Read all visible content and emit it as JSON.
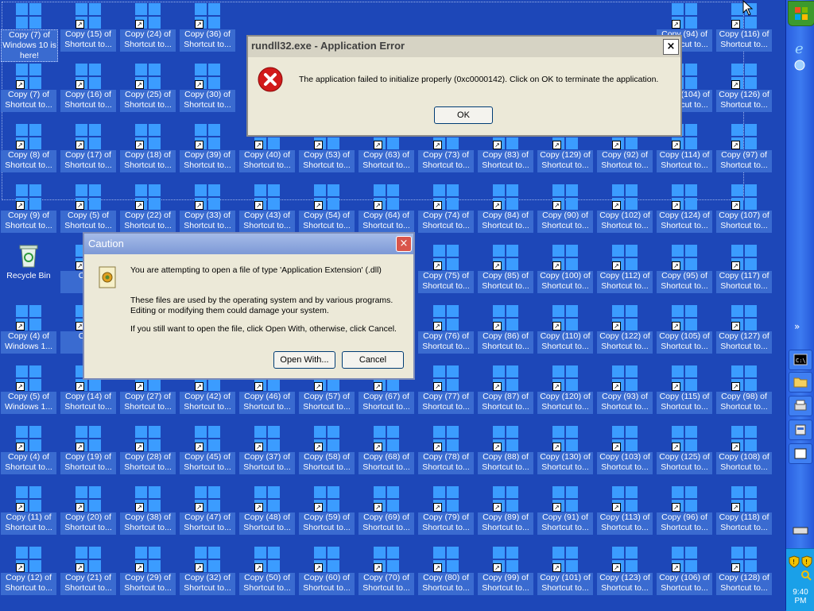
{
  "desktop": {
    "recycle_bin_label": "Recycle Bin",
    "columns": [
      [
        "Copy (7) of Windows 10 is here!",
        "Copy (7) of Shortcut to...",
        "Copy (8) of Shortcut to...",
        "Copy (9) of Shortcut to...",
        "",
        "Copy (4) of Windows 1...",
        "Copy (5) of Windows 1...",
        "Copy (4) of Shortcut to...",
        "Copy (11) of Shortcut to...",
        "Copy (12) of Shortcut to..."
      ],
      [
        "Copy (15) of Shortcut to...",
        "Copy (16) of Shortcut to...",
        "Copy (17) of Shortcut to...",
        "Copy (5) of Shortcut to...",
        "Copy",
        "Copy",
        "Copy (14) of Shortcut to...",
        "Copy (19) of Shortcut to...",
        "Copy (20) of Shortcut to...",
        "Copy (21) of Shortcut to..."
      ],
      [
        "Copy (24) of Shortcut to...",
        "Copy (25) of Shortcut to...",
        "Copy (18) of Shortcut to...",
        "Copy (22) of Shortcut to...",
        "",
        "",
        "Copy (27) of Shortcut to...",
        "Copy (28) of Shortcut to...",
        "Copy (38) of Shortcut to...",
        "Copy (29) of Shortcut to..."
      ],
      [
        "Copy (36) of Shortcut to...",
        "Copy (30) of Shortcut to...",
        "Copy (39) of Shortcut to...",
        "Copy (33) of Shortcut to...",
        "",
        "",
        "Copy (42) of Shortcut to...",
        "Copy (45) of Shortcut to...",
        "Copy (47) of Shortcut to...",
        "Copy (32) of Shortcut to..."
      ],
      [
        "",
        "",
        "Copy (40) of Shortcut to...",
        "Copy (43) of Shortcut to...",
        "",
        "",
        "Copy (46) of Shortcut to...",
        "Copy (37) of Shortcut to...",
        "Copy (48) of Shortcut to...",
        "Copy (50) of Shortcut to..."
      ],
      [
        "",
        "",
        "Copy (53) of Shortcut to...",
        "Copy (54) of Shortcut to...",
        "",
        "",
        "Copy (57) of Shortcut to...",
        "Copy (58) of Shortcut to...",
        "Copy (59) of Shortcut to...",
        "Copy (60) of Shortcut to..."
      ],
      [
        "",
        "",
        "Copy (63) of Shortcut to...",
        "Copy (64) of Shortcut to...",
        "",
        "",
        "Copy (67) of Shortcut to...",
        "Copy (68) of Shortcut to...",
        "Copy (69) of Shortcut to...",
        "Copy (70) of Shortcut to..."
      ],
      [
        "",
        "",
        "Copy (73) of Shortcut to...",
        "Copy (74) of Shortcut to...",
        "Copy (75) of Shortcut to...",
        "Copy (76) of Shortcut to...",
        "Copy (77) of Shortcut to...",
        "Copy (78) of Shortcut to...",
        "Copy (79) of Shortcut to...",
        "Copy (80) of Shortcut to..."
      ],
      [
        "",
        "",
        "Copy (83) of Shortcut to...",
        "Copy (84) of Shortcut to...",
        "Copy (85) of Shortcut to...",
        "Copy (86) of Shortcut to...",
        "Copy (87) of Shortcut to...",
        "Copy (88) of Shortcut to...",
        "Copy (89) of Shortcut to...",
        "Copy (99) of Shortcut to..."
      ],
      [
        "",
        "",
        "Copy (129) of Shortcut to...",
        "Copy (90) of Shortcut to...",
        "Copy (100) of Shortcut to...",
        "Copy (110) of Shortcut to...",
        "Copy (120) of Shortcut to...",
        "Copy (130) of Shortcut to...",
        "Copy (91) of Shortcut to...",
        "Copy (101) of Shortcut to..."
      ],
      [
        "",
        "",
        "Copy (92) of Shortcut to...",
        "Copy (102) of Shortcut to...",
        "Copy (112) of Shortcut to...",
        "Copy (122) of Shortcut to...",
        "Copy (93) of Shortcut to...",
        "Copy (103) of Shortcut to...",
        "Copy (113) of Shortcut to...",
        "Copy (123) of Shortcut to..."
      ],
      [
        "Copy (94) of Shortcut to...",
        "Copy (104) of Shortcut to...",
        "Copy (114) of Shortcut to...",
        "Copy (124) of Shortcut to...",
        "Copy (95) of Shortcut to...",
        "Copy (105) of Shortcut to...",
        "Copy (115) of Shortcut to...",
        "Copy (125) of Shortcut to...",
        "Copy (96) of Shortcut to...",
        "Copy (106) of Shortcut to..."
      ],
      [
        "Copy (116) of Shortcut to...",
        "Copy (126) of Shortcut to...",
        "Copy (97) of Shortcut to...",
        "Copy (107) of Shortcut to...",
        "Copy (117) of Shortcut to...",
        "Copy (127) of Shortcut to...",
        "Copy (98) of Shortcut to...",
        "Copy (108) of Shortcut to...",
        "Copy (118) of Shortcut to...",
        "Copy (128) of Shortcut to..."
      ]
    ]
  },
  "error_dialog": {
    "title": "rundll32.exe - Application Error",
    "message": "The application failed to initialize properly (0xc0000142). Click on OK to terminate the application.",
    "ok_label": "OK",
    "close_label": "×"
  },
  "caution_dialog": {
    "title": "Caution",
    "line1": "You are attempting to open a file of type 'Application Extension' (.dll)",
    "line2": "These files are used by the operating system and by various programs. Editing or modifying them could damage your system.",
    "line3": "If you still want to open the file, click Open With, otherwise, click Cancel.",
    "open_with_label": "Open With...",
    "cancel_label": "Cancel",
    "close_label": "×"
  },
  "taskbar": {
    "clock": "9:40 PM",
    "chevron": "»"
  },
  "colors": {
    "desktop": "#1d47b8",
    "taskbar": "#3d7bf0",
    "start_green": "#3c9a2d"
  }
}
